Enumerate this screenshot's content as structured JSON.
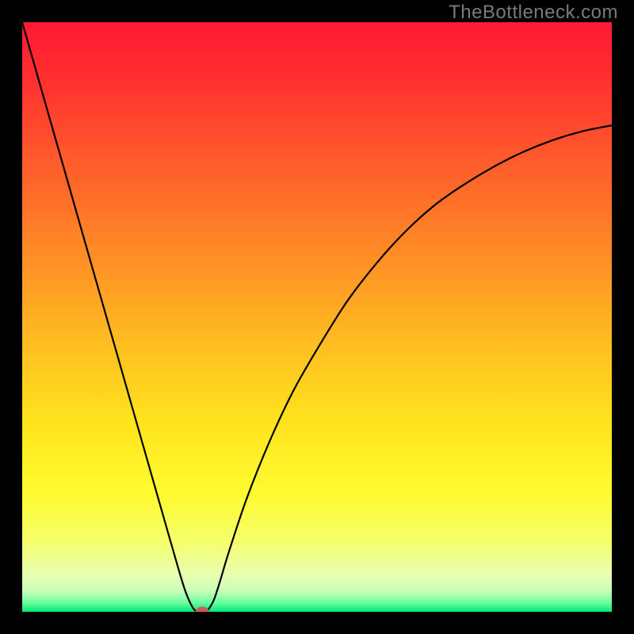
{
  "watermark": "TheBottleneck.com",
  "colors": {
    "frame": "#000000",
    "curve": "#000000",
    "dot": "#cf5a53",
    "watermark": "#7a7a7a"
  },
  "gradient_stops": [
    {
      "offset": 0.0,
      "color": "#ff1a33"
    },
    {
      "offset": 0.08,
      "color": "#ff2a30"
    },
    {
      "offset": 0.18,
      "color": "#ff4a2d"
    },
    {
      "offset": 0.3,
      "color": "#ff6f29"
    },
    {
      "offset": 0.42,
      "color": "#ff9525"
    },
    {
      "offset": 0.55,
      "color": "#ffbf21"
    },
    {
      "offset": 0.68,
      "color": "#ffe41d"
    },
    {
      "offset": 0.8,
      "color": "#fffb30"
    },
    {
      "offset": 0.88,
      "color": "#f5ff6a"
    },
    {
      "offset": 0.935,
      "color": "#e9ffb0"
    },
    {
      "offset": 0.965,
      "color": "#c8ffb8"
    },
    {
      "offset": 0.985,
      "color": "#66ff9e"
    },
    {
      "offset": 1.0,
      "color": "#00e676"
    }
  ],
  "chart_data": {
    "type": "line",
    "title": "",
    "xlabel": "",
    "ylabel": "",
    "xlim": [
      0,
      1
    ],
    "ylim": [
      0,
      1
    ],
    "series": [
      {
        "name": "bottleneck-curve",
        "x": [
          0.0,
          0.05,
          0.1,
          0.15,
          0.2,
          0.25,
          0.275,
          0.29,
          0.3,
          0.31,
          0.315,
          0.325,
          0.335,
          0.35,
          0.38,
          0.42,
          0.46,
          0.5,
          0.55,
          0.6,
          0.65,
          0.7,
          0.75,
          0.8,
          0.85,
          0.9,
          0.95,
          1.0
        ],
        "y": [
          1.0,
          0.825,
          0.65,
          0.475,
          0.3,
          0.125,
          0.04,
          0.006,
          0.0,
          0.0,
          0.003,
          0.02,
          0.05,
          0.1,
          0.19,
          0.29,
          0.375,
          0.445,
          0.525,
          0.59,
          0.645,
          0.69,
          0.725,
          0.755,
          0.78,
          0.8,
          0.815,
          0.825
        ]
      }
    ],
    "marker": {
      "x": 0.305,
      "y": 0.0,
      "color": "#cf5a53"
    }
  }
}
